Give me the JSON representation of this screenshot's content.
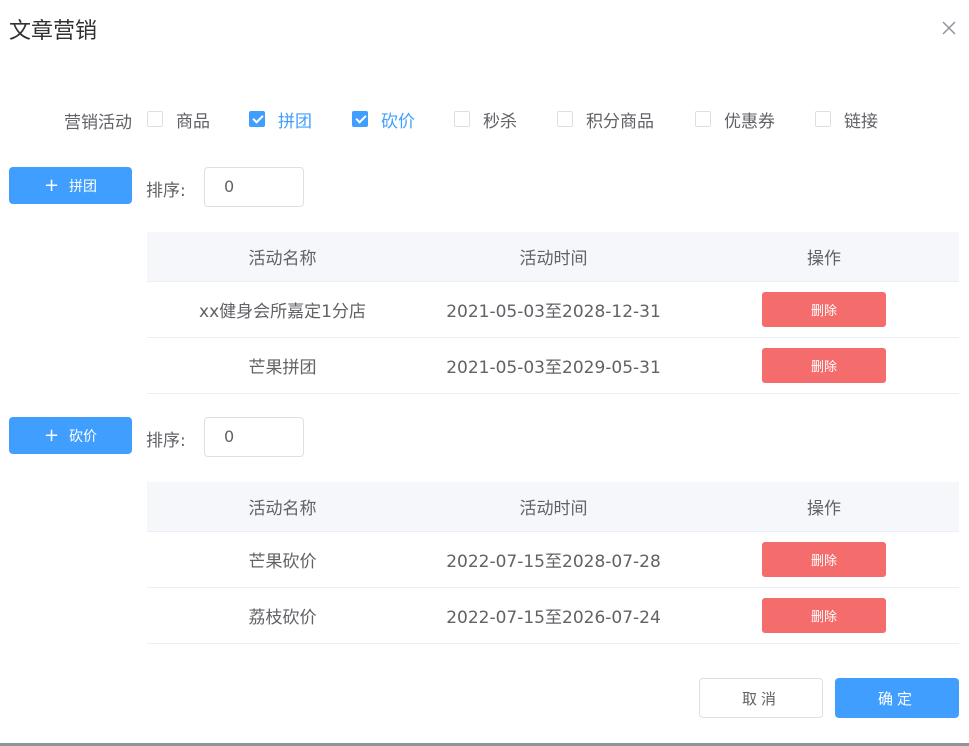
{
  "dialog": {
    "title": "文章营销",
    "close_icon": "close-icon"
  },
  "activities": {
    "label": "营销活动",
    "options": [
      {
        "label": "商品",
        "checked": false
      },
      {
        "label": "拼团",
        "checked": true
      },
      {
        "label": "砍价",
        "checked": true
      },
      {
        "label": "秒杀",
        "checked": false
      },
      {
        "label": "积分商品",
        "checked": false
      },
      {
        "label": "优惠券",
        "checked": false
      },
      {
        "label": "链接",
        "checked": false
      }
    ]
  },
  "sections": [
    {
      "add_label": "拼团",
      "plus": "+",
      "sort_label": "排序:",
      "sort_value": "0",
      "table": {
        "headers": [
          "活动名称",
          "活动时间",
          "操作"
        ],
        "rows": [
          {
            "name": "xx健身会所嘉定1分店",
            "time": "2021-05-03至2028-12-31",
            "action": "删除"
          },
          {
            "name": "芒果拼团",
            "time": "2021-05-03至2029-05-31",
            "action": "删除"
          }
        ]
      }
    },
    {
      "add_label": "砍价",
      "plus": "+",
      "sort_label": "排序:",
      "sort_value": "0",
      "table": {
        "headers": [
          "活动名称",
          "活动时间",
          "操作"
        ],
        "rows": [
          {
            "name": "芒果砍价",
            "time": "2022-07-15至2028-07-28",
            "action": "删除"
          },
          {
            "name": "荔枝砍价",
            "time": "2022-07-15至2026-07-24",
            "action": "删除"
          }
        ]
      }
    }
  ],
  "footer": {
    "cancel_label": "取消",
    "ok_label": "确定"
  },
  "colors": {
    "primary": "#409eff",
    "danger": "#f56c6c",
    "text": "#606266",
    "header_bg": "#f5f7fa"
  }
}
